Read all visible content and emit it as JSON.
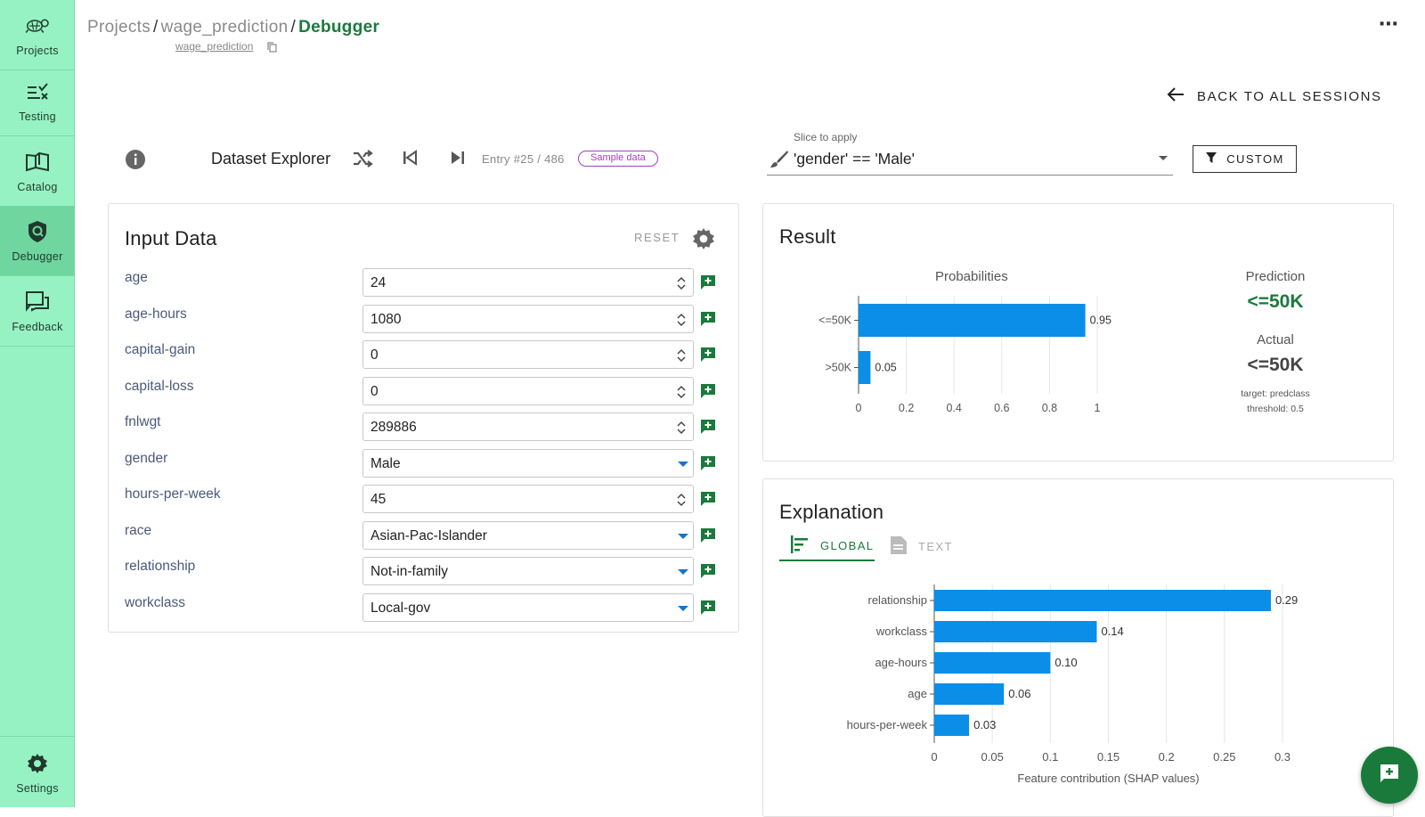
{
  "sidebar": {
    "items": [
      {
        "label": "Projects",
        "icon": "turtle-logo-icon"
      },
      {
        "label": "Testing",
        "icon": "testing-icon"
      },
      {
        "label": "Catalog",
        "icon": "catalog-book-icon"
      },
      {
        "label": "Debugger",
        "icon": "debugger-shield-icon"
      },
      {
        "label": "Feedback",
        "icon": "feedback-chat-icon"
      }
    ],
    "settings_label": "Settings"
  },
  "header": {
    "crumb_projects": "Projects",
    "crumb_project": "wage_prediction",
    "crumb_current": "Debugger",
    "sub_project": "wage_prediction"
  },
  "back_label": "BACK TO ALL SESSIONS",
  "toolbar": {
    "title": "Dataset Explorer",
    "entry": "Entry #25 / 486",
    "badge": "Sample data",
    "slice_label": "Slice to apply",
    "slice_value": "'gender' == 'Male'",
    "custom_label": "CUSTOM"
  },
  "input_card": {
    "title": "Input Data",
    "reset_label": "RESET",
    "fields": [
      {
        "label": "age",
        "value": "24",
        "kind": "number"
      },
      {
        "label": "age-hours",
        "value": "1080",
        "kind": "number"
      },
      {
        "label": "capital-gain",
        "value": "0",
        "kind": "number"
      },
      {
        "label": "capital-loss",
        "value": "0",
        "kind": "number"
      },
      {
        "label": "fnlwgt",
        "value": "289886",
        "kind": "number"
      },
      {
        "label": "gender",
        "value": "Male",
        "kind": "select"
      },
      {
        "label": "hours-per-week",
        "value": "45",
        "kind": "number"
      },
      {
        "label": "race",
        "value": "Asian-Pac-Islander",
        "kind": "select"
      },
      {
        "label": "relationship",
        "value": "Not-in-family",
        "kind": "select"
      },
      {
        "label": "workclass",
        "value": "Local-gov",
        "kind": "select"
      }
    ]
  },
  "result_card": {
    "title": "Result",
    "prediction_label": "Prediction",
    "prediction_value": "<=50K",
    "actual_label": "Actual",
    "actual_value": "<=50K",
    "target_text": "target: predclass",
    "threshold_text": "threshold: 0.5"
  },
  "explain_card": {
    "title": "Explanation",
    "tab_global": "GLOBAL",
    "tab_text": "TEXT"
  },
  "colors": {
    "sidebar": "#97f2c3",
    "accent_green": "#1a7a3c",
    "bar_blue": "#0a8ee8",
    "badge_purple": "#a040c0"
  },
  "chart_data": [
    {
      "type": "bar",
      "orientation": "horizontal",
      "title": "Probabilities",
      "categories": [
        "<=50K",
        ">50K"
      ],
      "values": [
        0.95,
        0.05
      ],
      "value_labels": [
        "0.95",
        "0.05"
      ],
      "xticks": [
        "0",
        "0.2",
        "0.4",
        "0.6",
        "0.8",
        "1"
      ],
      "xlim": [
        0,
        1
      ],
      "grid": true
    },
    {
      "type": "bar",
      "orientation": "horizontal",
      "xlabel": "Feature contribution (SHAP values)",
      "categories": [
        "relationship",
        "workclass",
        "age-hours",
        "age",
        "hours-per-week"
      ],
      "values": [
        0.29,
        0.14,
        0.1,
        0.06,
        0.03
      ],
      "value_labels": [
        "0.29",
        "0.14",
        "0.10",
        "0.06",
        "0.03"
      ],
      "xticks": [
        "0",
        "0.05",
        "0.1",
        "0.15",
        "0.2",
        "0.25",
        "0.3"
      ],
      "xlim": [
        0,
        0.3
      ],
      "grid": true
    }
  ]
}
